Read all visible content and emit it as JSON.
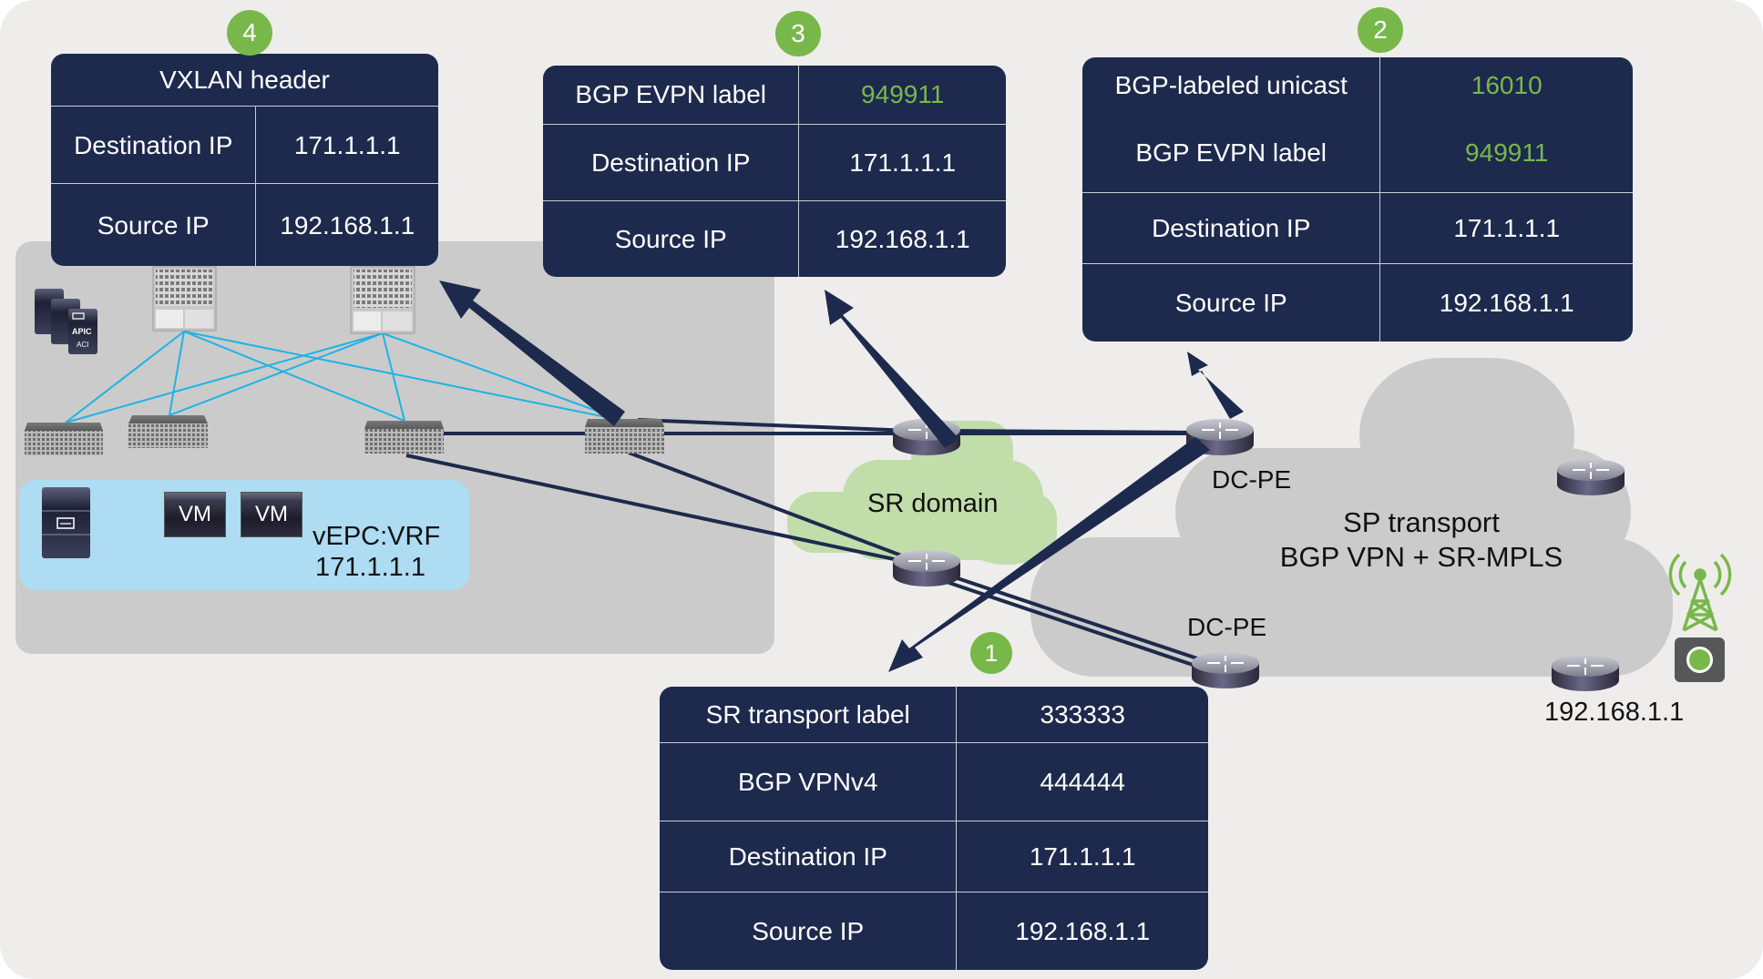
{
  "badges": {
    "b1": "1",
    "b2": "2",
    "b3": "3",
    "b4": "4"
  },
  "colors": {
    "header_bg": "#1d2a4d",
    "accent_green": "#78b84b",
    "link_cyan": "#1eb3e6",
    "link_dark": "#1d2a4d",
    "sr_cloud": "#c1ddaa",
    "sp_cloud": "#cbcbcb",
    "vrf_box": "#addcf3"
  },
  "box4": {
    "title": "VXLAN header",
    "rows": [
      {
        "label": "Destination IP",
        "value": "171.1.1.1"
      },
      {
        "label": "Source IP",
        "value": "192.168.1.1"
      }
    ]
  },
  "box3": {
    "rows": [
      {
        "label": "BGP EVPN label",
        "value": "949911",
        "highlight": true
      },
      {
        "label": "Destination IP",
        "value": "171.1.1.1"
      },
      {
        "label": "Source IP",
        "value": "192.168.1.1"
      }
    ]
  },
  "box2": {
    "rows": [
      {
        "label": "BGP-labeled unicast",
        "value": "16010",
        "highlight": true
      },
      {
        "label": "BGP EVPN label",
        "value": "949911",
        "highlight": true
      },
      {
        "label": "Destination IP",
        "value": "171.1.1.1"
      },
      {
        "label": "Source IP",
        "value": "192.168.1.1"
      }
    ]
  },
  "box1": {
    "rows": [
      {
        "label": "SR transport label",
        "value": "333333"
      },
      {
        "label": "BGP VPNv4",
        "value": "444444"
      },
      {
        "label": "Destination IP",
        "value": "171.1.1.1"
      },
      {
        "label": "Source IP",
        "value": "192.168.1.1"
      }
    ]
  },
  "dc": {
    "vm1": "VM",
    "vm2": "VM",
    "vrf_name": "vEPC:VRF",
    "vrf_ip": "171.1.1.1",
    "apic_label": "APIC",
    "aci_label": "ACI"
  },
  "sr_domain": {
    "label": "SR domain"
  },
  "sp": {
    "title_line1": "SP transport",
    "title_line2": "BGP VPN + SR-MPLS",
    "dcpe_top": "DC-PE",
    "dcpe_bottom": "DC-PE",
    "source_ip": "192.168.1.1"
  }
}
